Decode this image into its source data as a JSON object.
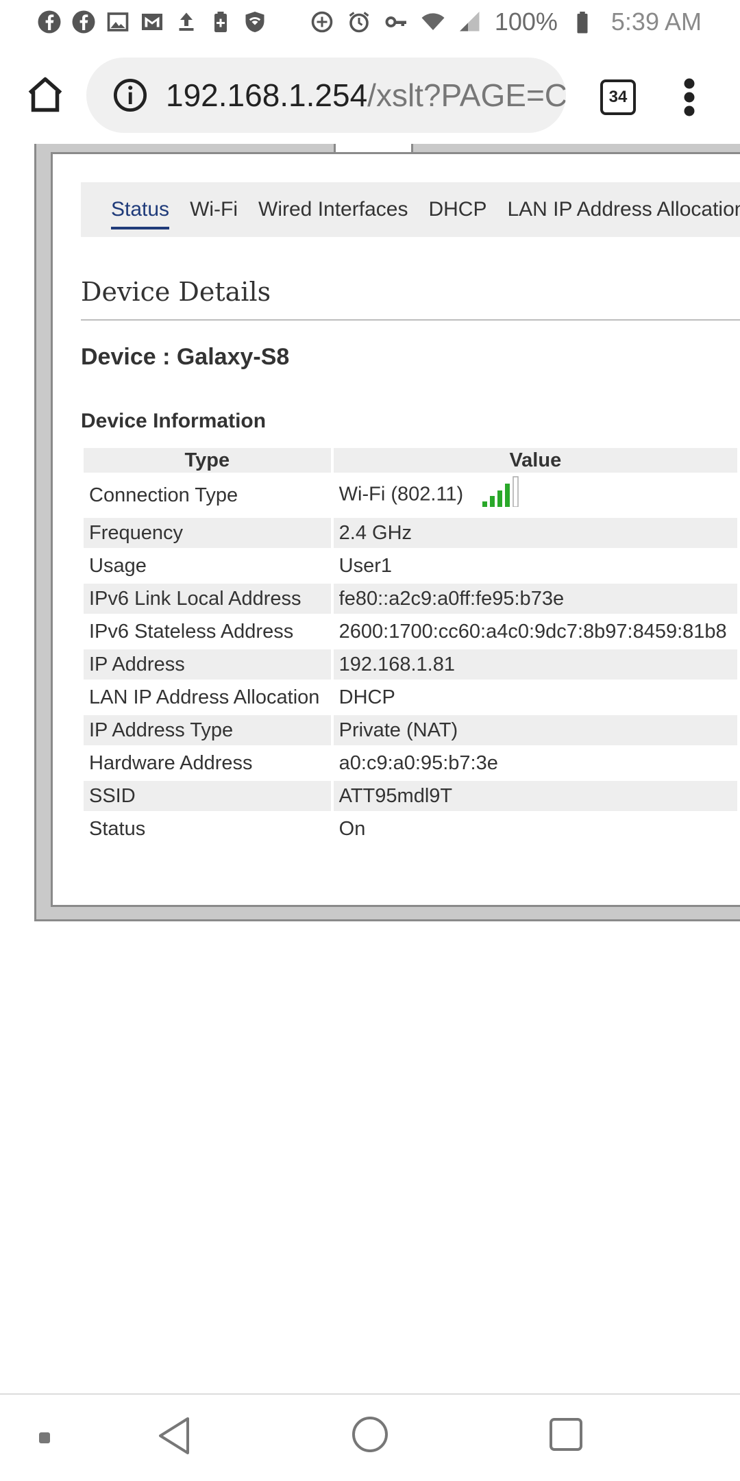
{
  "status_bar": {
    "left_icons": [
      "facebook-icon",
      "facebook-icon",
      "image-icon",
      "gmail-icon",
      "upload-icon",
      "battery-saver-icon",
      "shield-wifi-icon"
    ],
    "right_icons": [
      "data-saver-icon",
      "alarm-icon",
      "vpn-key-icon",
      "wifi-icon",
      "signal-icon"
    ],
    "battery": "100%",
    "time": "5:39 AM"
  },
  "browser": {
    "url_host": "192.168.1.254",
    "url_path": "/xslt?PAGE=C",
    "tab_count": "34"
  },
  "subnav": {
    "items": [
      {
        "label": "Status",
        "active": true
      },
      {
        "label": "Wi-Fi",
        "active": false
      },
      {
        "label": "Wired Interfaces",
        "active": false
      },
      {
        "label": "DHCP",
        "active": false
      },
      {
        "label": "LAN IP Address Allocation",
        "active": false
      }
    ]
  },
  "page": {
    "section_title": "Device Details",
    "device_line": "Device : Galaxy-S8",
    "info_title": "Device Information",
    "table": {
      "headers": [
        "Type",
        "Value"
      ],
      "rows": [
        {
          "type": "Connection Type",
          "value": "Wi-Fi (802.11)",
          "signal_bars": 4,
          "signal_max": 5
        },
        {
          "type": "Frequency",
          "value": "2.4 GHz"
        },
        {
          "type": "Usage",
          "value": "User1"
        },
        {
          "type": "IPv6 Link Local Address",
          "value": "fe80::a2c9:a0ff:fe95:b73e"
        },
        {
          "type": "IPv6 Stateless Address",
          "value": "2600:1700:cc60:a4c0:9dc7:8b97:8459:81b8"
        },
        {
          "type": "IP Address",
          "value": "192.168.1.81"
        },
        {
          "type": "LAN IP Address Allocation",
          "value": "DHCP"
        },
        {
          "type": "IP Address Type",
          "value": "Private (NAT)"
        },
        {
          "type": "Hardware Address",
          "value": "a0:c9:a0:95:b7:3e"
        },
        {
          "type": "SSID",
          "value": "ATT95mdl9T"
        },
        {
          "type": "Status",
          "value": "On"
        }
      ]
    }
  },
  "colors": {
    "active_tab": "#1f3b7a",
    "signal_green": "#2aa82a",
    "row_alt": "#eeeeee",
    "frame": "#c9c9c9"
  }
}
